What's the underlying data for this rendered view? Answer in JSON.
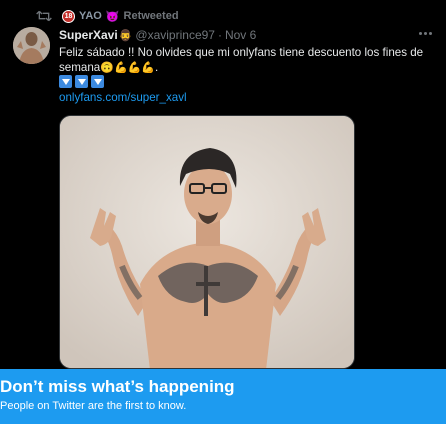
{
  "retweet": {
    "badge": "18",
    "user_name": "YAO",
    "user_emoji": "😈",
    "label": "Retweeted",
    "icon": "retweet-icon"
  },
  "author": {
    "display_name": "SuperXavi",
    "name_emoji": "🧔‍♂️",
    "handle": "@xaviprince97",
    "separator": "·",
    "date": "Nov 6"
  },
  "tweet": {
    "text_line1": "Feliz sábado !! No olvides que mi onlyfans tiene descuento los fines de",
    "text_line2_prefix": "semana",
    "text_line2_emojis": "🙃💪💪💪",
    "text_line2_suffix": ".",
    "link": "onlyfans.com/super_xavl",
    "arrow_count": 3
  },
  "banner": {
    "title": "Don’t miss what’s happening",
    "subtitle": "People on Twitter are the first to know."
  },
  "colors": {
    "background": "#000000",
    "link": "#1d9bf0",
    "banner": "#1d9bf0",
    "muted": "#71767b"
  }
}
